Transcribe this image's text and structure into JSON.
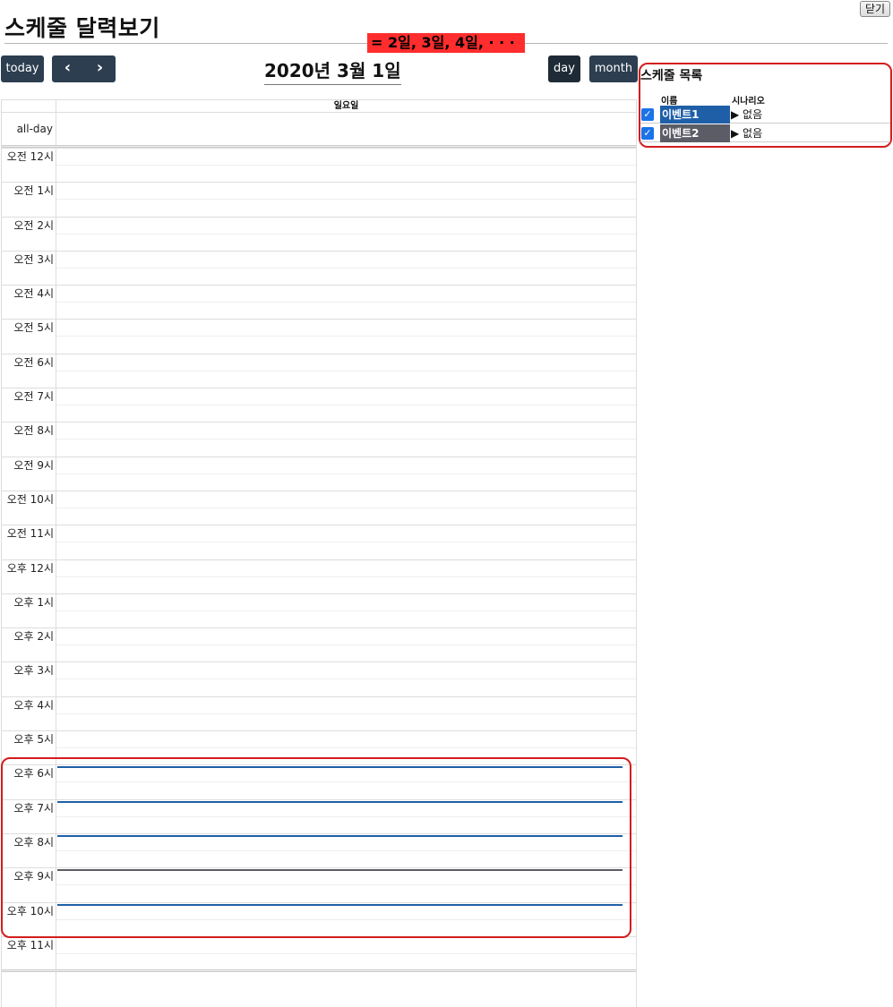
{
  "page": {
    "title": "스케줄 달력보기",
    "close_label": "닫기",
    "annotation": "= 2일, 3일, 4일, · · ·"
  },
  "toolbar": {
    "today_label": "today",
    "prev_label": "‹",
    "next_label": "›",
    "title": "2020년 3월 1일",
    "day_label": "day",
    "month_label": "month"
  },
  "calendar": {
    "day_header": "일요일",
    "allday_label": "all-day",
    "hours": [
      "오전 12시",
      "오전 1시",
      "오전 2시",
      "오전 3시",
      "오전 4시",
      "오전 5시",
      "오전 6시",
      "오전 7시",
      "오전 8시",
      "오전 9시",
      "오전 10시",
      "오전 11시",
      "오후 12시",
      "오후 1시",
      "오후 2시",
      "오후 3시",
      "오후 4시",
      "오후 5시",
      "오후 6시",
      "오후 7시",
      "오후 8시",
      "오후 9시",
      "오후 10시",
      "오후 11시"
    ],
    "events": [
      {
        "hour": 18,
        "color": "#1f5fa8"
      },
      {
        "hour": 19,
        "color": "#1f5fa8"
      },
      {
        "hour": 20,
        "color": "#1f5fa8"
      },
      {
        "hour": 21,
        "color": "#5c5c66"
      },
      {
        "hour": 22,
        "color": "#1f5fa8"
      }
    ]
  },
  "schedule_list": {
    "title": "스케줄 목록",
    "col_name": "이름",
    "col_scenario": "시나리오",
    "items": [
      {
        "name": "이벤트1",
        "scenario": "▶ 없음",
        "color": "#1f5fa8",
        "checked": true
      },
      {
        "name": "이벤트2",
        "scenario": "▶ 없음",
        "color": "#5c5c66",
        "checked": true
      }
    ]
  },
  "colors": {
    "accent_red": "#d31d1d",
    "button_bg": "#2c3e50",
    "event_blue": "#1f5fa8",
    "event_gray": "#5c5c66"
  }
}
